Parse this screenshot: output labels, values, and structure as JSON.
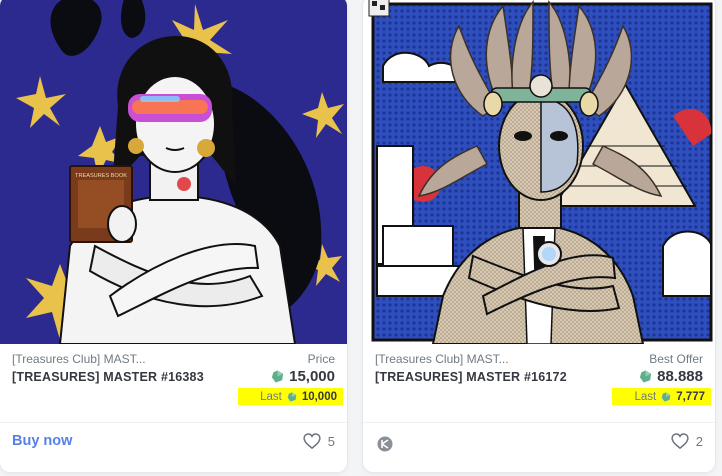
{
  "cards": [
    {
      "collection": "[Treasures Club] MAST...",
      "name": "[TREASURES] MASTER #16383",
      "price_label": "Price",
      "price": "15,000",
      "last_label": "Last",
      "last_price": "10,000",
      "action_label": "Buy now",
      "likes": "5",
      "book_text": "TREASURES BOOK"
    },
    {
      "collection": "[Treasures Club] MAST...",
      "name": "[TREASURES] MASTER #16172",
      "price_label": "Best Offer",
      "price": "88.888",
      "last_label": "Last",
      "last_price": "7,777",
      "likes": "2"
    }
  ],
  "icons": {
    "currency": "klay-coin-icon",
    "like": "heart-outline-icon",
    "chain": "klaytn-chain-icon"
  },
  "colors": {
    "highlight": "#ffff00",
    "accent": "#5680e9",
    "coin": "#5fae8c",
    "art1_background": "#2d2a8f",
    "art2_background": "#2f4fbf"
  }
}
